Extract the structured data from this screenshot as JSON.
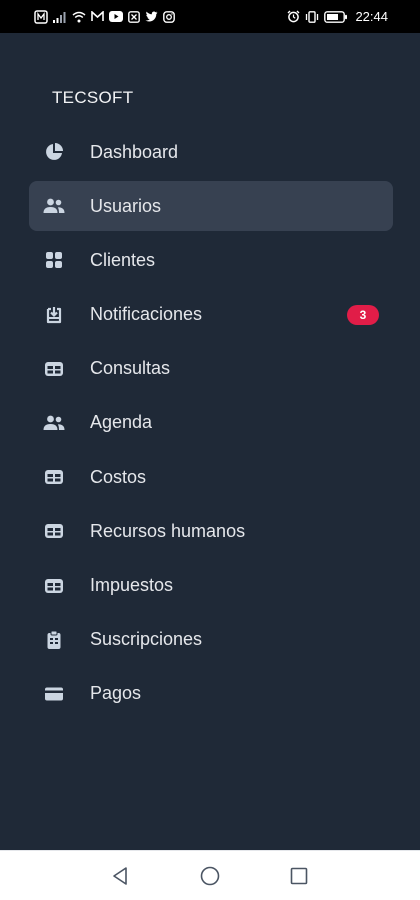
{
  "status_bar": {
    "time": "22:44",
    "left_icons": [
      "app-icon",
      "signal-icon",
      "wifi-icon",
      "mail-icon",
      "youtube-icon",
      "extra-icon",
      "twitter-icon",
      "instagram-icon"
    ],
    "right_icons": [
      "alarm-icon",
      "vibrate-icon",
      "battery-icon"
    ]
  },
  "drawer": {
    "brand": "TECSOFT",
    "items": [
      {
        "label": "Dashboard",
        "icon": "pie-chart-icon",
        "active": false
      },
      {
        "label": "Usuarios",
        "icon": "users-icon",
        "active": true
      },
      {
        "label": "Clientes",
        "icon": "grid-icon",
        "active": false
      },
      {
        "label": "Notificaciones",
        "icon": "inbox-icon",
        "active": false,
        "badge": "3"
      },
      {
        "label": "Consultas",
        "icon": "table-icon",
        "active": false
      },
      {
        "label": "Agenda",
        "icon": "users-icon",
        "active": false
      },
      {
        "label": "Costos",
        "icon": "table-icon",
        "active": false
      },
      {
        "label": "Recursos humanos",
        "icon": "table-icon",
        "active": false
      },
      {
        "label": "Impuestos",
        "icon": "table-icon",
        "active": false
      },
      {
        "label": "Suscripciones",
        "icon": "clipboard-icon",
        "active": false
      },
      {
        "label": "Pagos",
        "icon": "credit-card-icon",
        "active": false
      }
    ]
  },
  "colors": {
    "background": "#1f2937",
    "active_item": "#374151",
    "badge": "#e11d48",
    "text": "#e5e7eb"
  },
  "nav_bar": {
    "buttons": [
      "back-icon",
      "home-icon",
      "recents-icon"
    ]
  }
}
